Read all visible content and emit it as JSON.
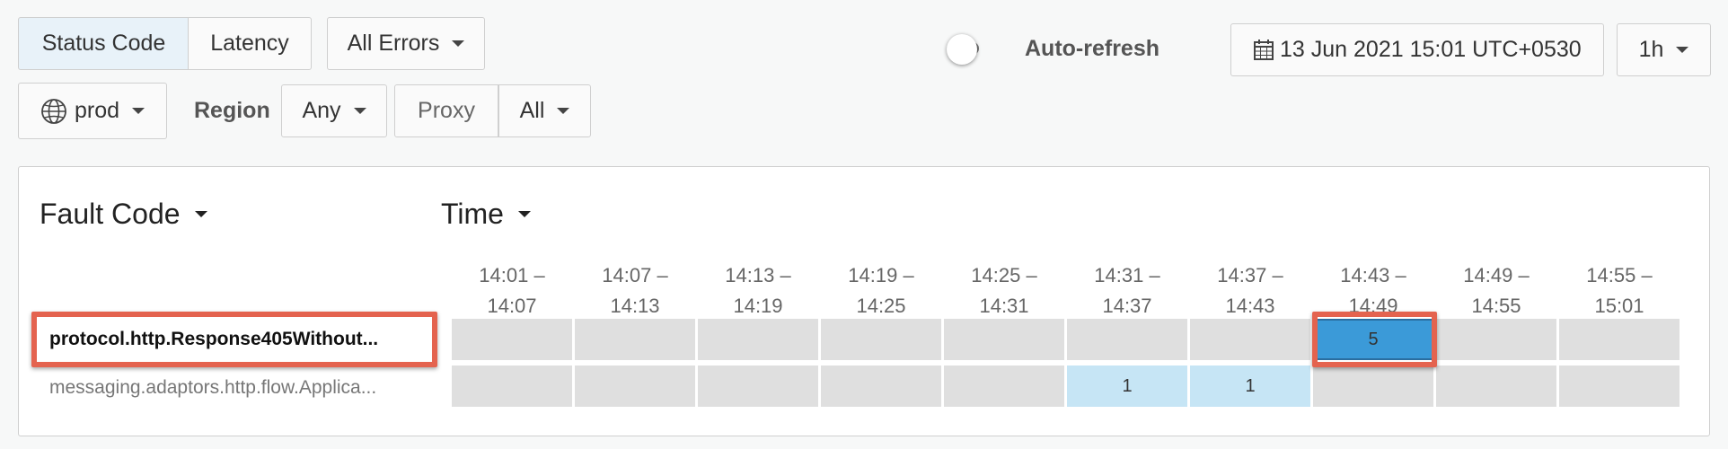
{
  "toolbar": {
    "tab_status_code": "Status Code",
    "tab_latency": "Latency",
    "errors_dropdown": "All Errors",
    "auto_refresh_label": "Auto-refresh",
    "datetime": "13 Jun 2021 15:01 UTC+0530",
    "range_dropdown": "1h"
  },
  "filters": {
    "env_dropdown": "prod",
    "region_label": "Region",
    "region_dropdown": "Any",
    "proxy_label": "Proxy",
    "proxy_dropdown": "All"
  },
  "panel": {
    "row_dimension": "Fault Code",
    "column_dimension": "Time",
    "time_buckets": [
      {
        "start": "14:01 –",
        "end": "14:07"
      },
      {
        "start": "14:07 –",
        "end": "14:13"
      },
      {
        "start": "14:13 –",
        "end": "14:19"
      },
      {
        "start": "14:19 –",
        "end": "14:25"
      },
      {
        "start": "14:25 –",
        "end": "14:31"
      },
      {
        "start": "14:31 –",
        "end": "14:37"
      },
      {
        "start": "14:37 –",
        "end": "14:43"
      },
      {
        "start": "14:43 –",
        "end": "14:49"
      },
      {
        "start": "14:49 –",
        "end": "14:55"
      },
      {
        "start": "14:55 –",
        "end": "15:01"
      }
    ],
    "rows": [
      {
        "fault_code": "protocol.http.Response405Without...",
        "values": [
          "",
          "",
          "",
          "",
          "",
          "",
          "",
          "5",
          "",
          ""
        ]
      },
      {
        "fault_code": "messaging.adaptors.http.flow.Applica...",
        "values": [
          "",
          "",
          "",
          "",
          "",
          "1",
          "1",
          "",
          "",
          ""
        ]
      }
    ]
  },
  "colors": {
    "empty_cell": "#dfdfdf",
    "low_count": "#c6e5f5",
    "high_count": "#3b9ad8",
    "highlight_border": "#e4634f"
  }
}
